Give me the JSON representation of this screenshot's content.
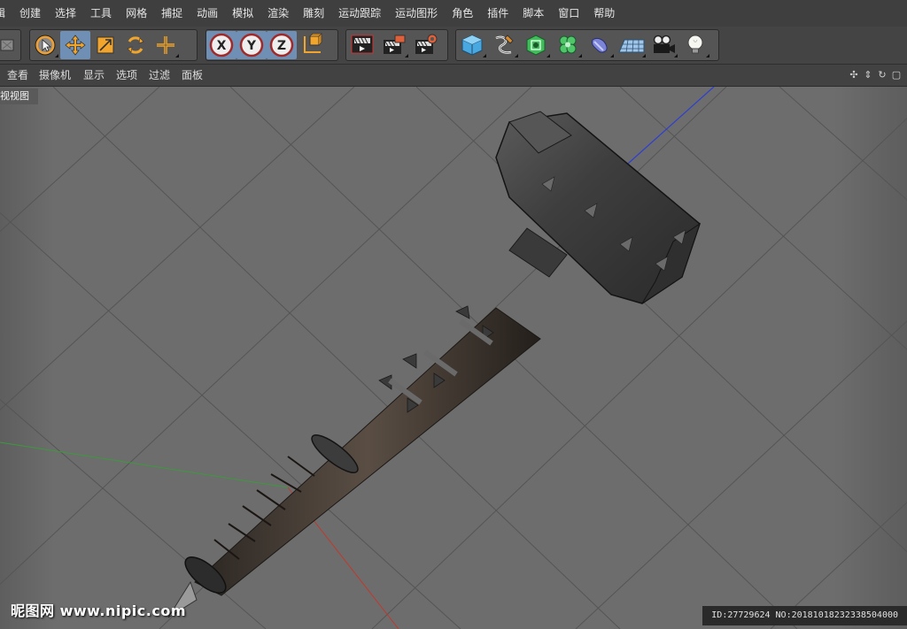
{
  "menu": {
    "items": [
      "辑",
      "创建",
      "选择",
      "工具",
      "网格",
      "捕捉",
      "动画",
      "模拟",
      "渲染",
      "雕刻",
      "运动跟踪",
      "运动图形",
      "角色",
      "插件",
      "脚本",
      "窗口",
      "帮助"
    ]
  },
  "toolbar": {
    "tools": [
      {
        "name": "undo-panel-icon"
      },
      {
        "name": "select-arrow-icon"
      },
      {
        "name": "move-icon"
      },
      {
        "name": "scale-icon"
      },
      {
        "name": "rotate-icon"
      },
      {
        "name": "move-plus-icon"
      },
      {
        "name": "axis-x-icon",
        "label": "X"
      },
      {
        "name": "axis-y-icon",
        "label": "Y"
      },
      {
        "name": "axis-z-icon",
        "label": "Z"
      },
      {
        "name": "coordinate-system-icon"
      },
      {
        "name": "render-view-icon"
      },
      {
        "name": "render-picture-viewer-icon"
      },
      {
        "name": "render-settings-icon"
      },
      {
        "name": "cube-icon"
      },
      {
        "name": "spline-pen-icon"
      },
      {
        "name": "subdivision-icon"
      },
      {
        "name": "cloner-icon"
      },
      {
        "name": "deformer-icon"
      },
      {
        "name": "floor-icon"
      },
      {
        "name": "camera-icon"
      },
      {
        "name": "light-icon"
      }
    ]
  },
  "viewmenu": {
    "items": [
      "查看",
      "摄像机",
      "显示",
      "选项",
      "过滤",
      "面板"
    ]
  },
  "viewport": {
    "label": "视视图"
  },
  "watermark": {
    "left": "昵图网 www.nipic.com",
    "right": "ID:27729624 NO:20181018232338504000"
  },
  "colors": {
    "accent": "#6f8fb5",
    "axis_x": "#c0392b",
    "axis_y": "#3c9a3c",
    "axis_z": "#2f3fd0",
    "viewport_bg": "#6c6c6c"
  }
}
